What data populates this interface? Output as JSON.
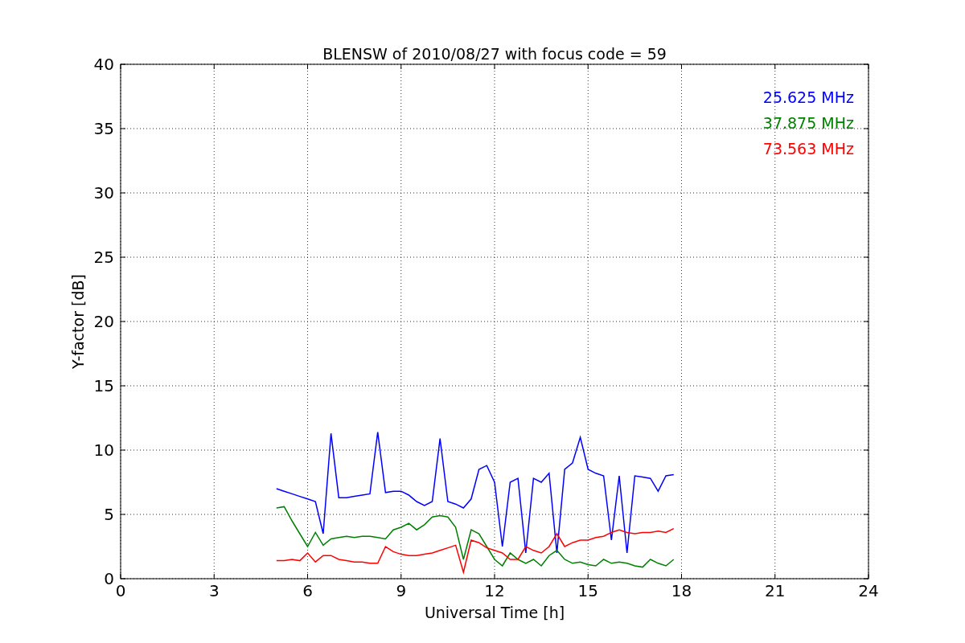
{
  "figure": {
    "chart_data": {
      "type": "line",
      "title": "BLENSW of 2010/08/27 with focus code = 59",
      "xlabel": "Universal Time [h]",
      "ylabel": "Y-factor [dB]",
      "x": [
        5,
        5.25,
        5.5,
        5.75,
        6,
        6.25,
        6.5,
        6.75,
        7,
        7.25,
        7.5,
        7.75,
        8,
        8.25,
        8.5,
        8.75,
        9,
        9.25,
        9.5,
        9.75,
        10,
        10.25,
        10.5,
        10.75,
        11,
        11.25,
        11.5,
        11.75,
        12,
        12.25,
        12.5,
        12.75,
        13,
        13.25,
        13.5,
        13.75,
        14,
        14.25,
        14.5,
        14.75,
        15,
        15.25,
        15.5,
        15.75,
        16,
        16.25,
        16.5,
        16.75,
        17,
        17.25,
        17.5,
        17.75
      ],
      "series": [
        {
          "name": "25.625 MHz",
          "color": "#0000ff",
          "values": [
            7,
            6.8,
            6.6,
            6.4,
            6.2,
            6.0,
            3.5,
            11.3,
            6.3,
            6.3,
            6.4,
            6.5,
            6.6,
            11.4,
            6.7,
            6.8,
            6.8,
            6.5,
            6.0,
            5.7,
            6.0,
            10.9,
            6.0,
            5.8,
            5.5,
            6.2,
            8.5,
            8.8,
            7.5,
            2.5,
            7.5,
            7.8,
            2.0,
            7.8,
            7.5,
            8.2,
            2.0,
            8.5,
            9.0,
            11.0,
            8.5,
            8.2,
            8.0,
            3.0,
            8.0,
            2.0,
            8.0,
            7.9,
            7.8,
            6.8,
            8.0,
            8.1
          ]
        },
        {
          "name": "37.875 MHz",
          "color": "#008000",
          "values": [
            5.5,
            5.6,
            4.5,
            3.5,
            2.5,
            3.6,
            2.6,
            3.1,
            3.2,
            3.3,
            3.2,
            3.3,
            3.3,
            3.2,
            3.1,
            3.8,
            4.0,
            4.3,
            3.8,
            4.2,
            4.8,
            4.9,
            4.8,
            4.0,
            1.5,
            3.8,
            3.5,
            2.5,
            1.5,
            1.0,
            2.0,
            1.5,
            1.2,
            1.5,
            1.0,
            1.8,
            2.2,
            1.5,
            1.2,
            1.3,
            1.1,
            1.0,
            1.5,
            1.2,
            1.3,
            1.2,
            1.0,
            0.9,
            1.5,
            1.2,
            1.0,
            1.5
          ]
        },
        {
          "name": "73.563 MHz",
          "color": "#ff0000",
          "values": [
            1.4,
            1.4,
            1.5,
            1.4,
            2.0,
            1.3,
            1.8,
            1.8,
            1.5,
            1.4,
            1.3,
            1.3,
            1.2,
            1.2,
            2.5,
            2.1,
            1.9,
            1.8,
            1.8,
            1.9,
            2.0,
            2.2,
            2.4,
            2.6,
            0.5,
            3.0,
            2.8,
            2.4,
            2.2,
            2.0,
            1.5,
            1.5,
            2.5,
            2.2,
            2.0,
            2.5,
            3.5,
            2.5,
            2.8,
            3.0,
            3.0,
            3.2,
            3.3,
            3.6,
            3.8,
            3.6,
            3.5,
            3.6,
            3.6,
            3.7,
            3.6,
            3.9
          ]
        }
      ],
      "grid": true,
      "xlim": [
        0,
        24
      ],
      "ylim": [
        0,
        40
      ],
      "xticks": [
        0,
        3,
        6,
        9,
        12,
        15,
        18,
        21,
        24
      ],
      "yticks": [
        0,
        5,
        10,
        15,
        20,
        25,
        30,
        35,
        40
      ]
    }
  }
}
